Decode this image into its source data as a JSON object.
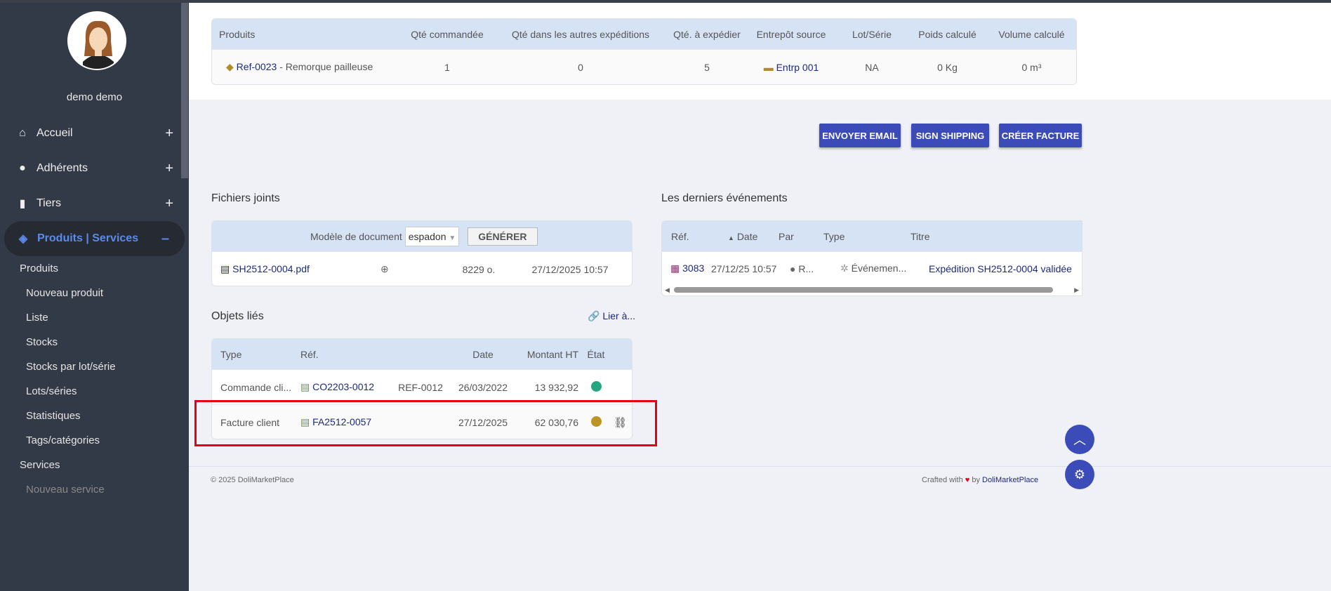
{
  "user": {
    "name": "demo demo"
  },
  "menu": [
    {
      "label": "Accueil",
      "icon": "home-icon",
      "toggle": "+"
    },
    {
      "label": "Adhérents",
      "icon": "user-icon",
      "toggle": "+"
    },
    {
      "label": "Tiers",
      "icon": "building-icon",
      "toggle": "+"
    },
    {
      "label": "Produits | Services",
      "icon": "cube-icon",
      "toggle": "–"
    }
  ],
  "submenu": [
    "Produits",
    "Nouveau produit",
    "Liste",
    "Stocks",
    "Stocks par lot/série",
    "Lots/séries",
    "Statistiques",
    "Tags/catégories",
    "Services",
    "Nouveau service"
  ],
  "lines": {
    "headers": [
      "Produits",
      "Qté commandée",
      "Qté dans les autres expéditions",
      "Qté. à expédier",
      "Entrepôt source",
      "Lot/Série",
      "Poids calculé",
      "Volume calculé"
    ],
    "row": {
      "ref": "Ref-0023",
      "label": " - Remorque pailleuse",
      "ordered": "1",
      "other": "0",
      "toship": "5",
      "warehouse": "Entrp 001",
      "lot": "NA",
      "weight": "0 Kg",
      "volume": "0 m³"
    }
  },
  "actions": {
    "email": "ENVOYER EMAIL",
    "sign": "SIGN SHIPPING",
    "invoice": "CRÉER FACTURE"
  },
  "files": {
    "title": "Fichiers joints",
    "model_label": "Modèle de document",
    "model_value": "espadon",
    "generate": "GÉNÉRER",
    "row": {
      "name": "SH2512-0004.pdf",
      "size": "8229 o.",
      "date": "27/12/2025 10:57"
    }
  },
  "events": {
    "title": "Les derniers événements",
    "headers": [
      "Réf.",
      "Date",
      "Par",
      "Type",
      "Titre"
    ],
    "row": {
      "ref": "3083",
      "date": "27/12/25 10:57",
      "by": "R...",
      "type": "Événemen...",
      "title": "Expédition SH2512-0004 validée"
    }
  },
  "linked": {
    "title": "Objets liés",
    "link_label": "Lier à...",
    "headers": [
      "Type",
      "Réf.",
      "Date",
      "Montant HT",
      "État"
    ],
    "rows": [
      {
        "type": "Commande cli...",
        "ref": "CO2203-0012",
        "ref2": "REF-0012",
        "date": "26/03/2022",
        "amount": "13 932,92",
        "status_color": "#25a580"
      },
      {
        "type": "Facture client",
        "ref": "FA2512-0057",
        "ref2": "",
        "date": "27/12/2025",
        "amount": "62 030,76",
        "status_color": "#bd9526"
      }
    ]
  },
  "footer": {
    "copyright": "© 2025 DoliMarketPlace",
    "crafted": "Crafted with",
    "by": "by",
    "brand": "DoliMarketPlace"
  }
}
